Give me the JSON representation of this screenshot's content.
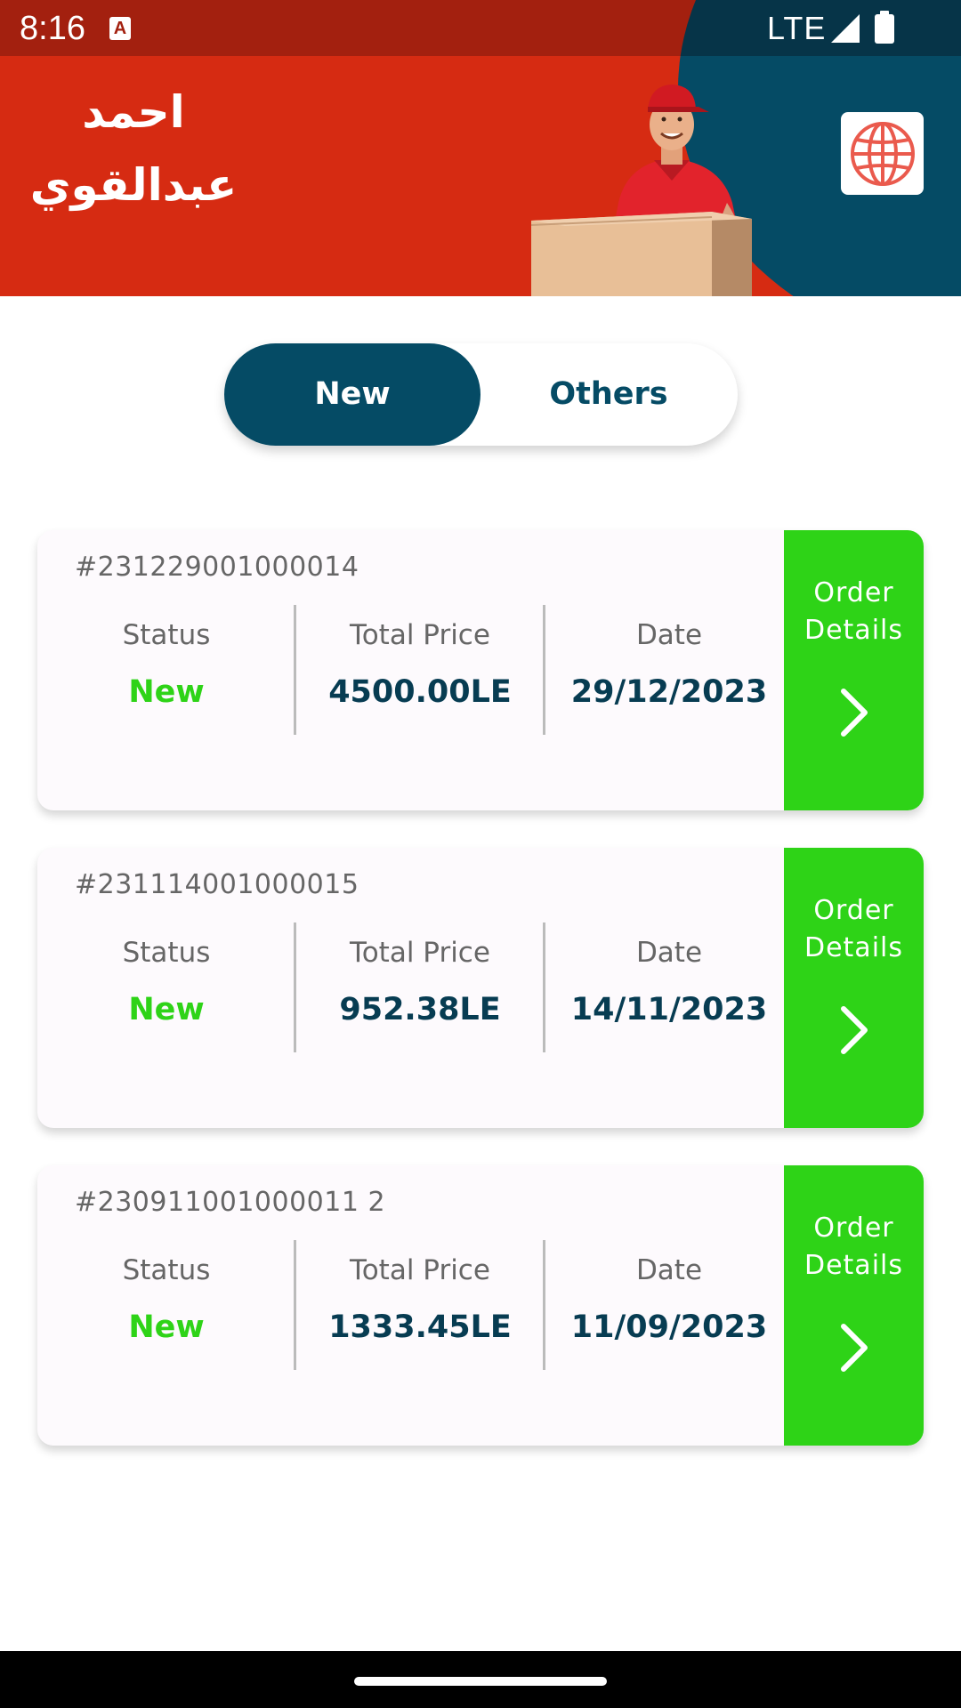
{
  "status_bar": {
    "time": "8:16",
    "notification_icon": "a-icon",
    "network": "LTE",
    "signal_icon": "signal-icon",
    "battery_icon": "battery-icon"
  },
  "header": {
    "user_name_line1": "احمد",
    "user_name_line2": "عبدالقوي",
    "language_icon": "globe-icon"
  },
  "tabs": {
    "new_label": "New",
    "others_label": "Others",
    "selected": "New"
  },
  "orders": [
    {
      "id": "#231229001000014",
      "status_label": "Status",
      "status": "New",
      "price_label": "Total Price",
      "price": "4500.00LE",
      "date_label": "Date",
      "date": "29/12/2023",
      "details_label": "Order Details"
    },
    {
      "id": "#231114001000015",
      "status_label": "Status",
      "status": "New",
      "price_label": "Total Price",
      "price": "952.38LE",
      "date_label": "Date",
      "date": "14/11/2023",
      "details_label": "Order Details"
    },
    {
      "id": "#230911001000011 2",
      "status_label": "Status",
      "status": "New",
      "price_label": "Total Price",
      "price": "1333.45LE",
      "date_label": "Date",
      "date": "11/09/2023",
      "details_label": "Order Details"
    }
  ],
  "colors": {
    "header_red": "#d62b12",
    "status_bar_red": "#a3200f",
    "navy": "#054b65",
    "green": "#2ed317",
    "text_dark": "#073c52",
    "text_gray": "#666666"
  }
}
